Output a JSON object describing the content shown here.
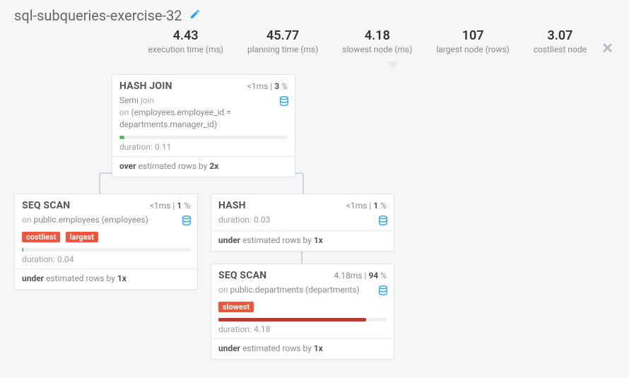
{
  "title": "sql-subqueries-exercise-32",
  "metrics": {
    "execution_time": {
      "value": "4.43",
      "label": "execution time (ms)"
    },
    "planning_time": {
      "value": "45.77",
      "label": "planning time (ms)"
    },
    "slowest_node": {
      "value": "4.18",
      "label": "slowest node (ms)"
    },
    "largest_node": {
      "value": "107",
      "label": "largest node (rows)"
    },
    "costliest_node": {
      "value": "3.07",
      "label": "costliest node"
    }
  },
  "nodes": {
    "hash_join": {
      "name": "HASH JOIN",
      "time": "<1ms",
      "pct": "3",
      "verb": "Semi",
      "join_word": "join",
      "on_prefix": "on",
      "on": "(employees.employee_id = departments.manager_id)",
      "bar_fill_pct": 3,
      "bar_color": "green",
      "duration": "duration: 0.11",
      "est_prefix": "over",
      "est_text": "estimated rows by",
      "est_factor": "2x"
    },
    "seq_scan_emp": {
      "name": "SEQ SCAN",
      "time": "<1ms",
      "pct": "1",
      "on_prefix": "on",
      "on": "public.employees (employees)",
      "badges": [
        "costliest",
        "largest"
      ],
      "bar_fill_pct": 1,
      "bar_color": "green",
      "duration": "duration: 0.04",
      "est_prefix": "under",
      "est_text": "estimated rows by",
      "est_factor": "1x"
    },
    "hash": {
      "name": "HASH",
      "time": "<1ms",
      "pct": "1",
      "duration": "duration: 0.03",
      "est_prefix": "under",
      "est_text": "estimated rows by",
      "est_factor": "1x"
    },
    "seq_scan_dep": {
      "name": "SEQ SCAN",
      "time": "4.18ms",
      "pct": "94",
      "on_prefix": "on",
      "on": "public.departments (departments)",
      "badges": [
        "slowest"
      ],
      "bar_fill_pct": 88,
      "bar_color": "red",
      "duration": "duration: 4.18",
      "est_prefix": "under",
      "est_text": "estimated rows by",
      "est_factor": "1x"
    }
  }
}
